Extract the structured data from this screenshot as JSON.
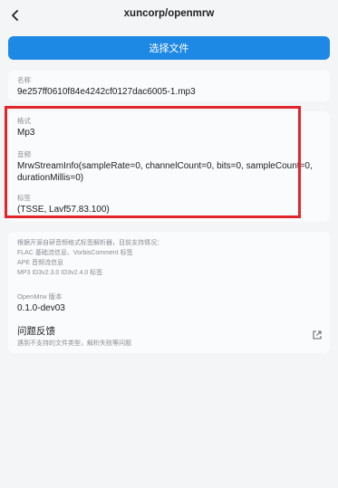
{
  "header": {
    "title": "xuncorp/openmrw",
    "back_icon": "chevron-left-icon"
  },
  "select_button": {
    "label": "选择文件"
  },
  "file_card": {
    "name_label": "名称",
    "name_value": "9e257ff0610f84e4242cf0127dac6005-1.mp3"
  },
  "meta_card": {
    "format_label": "格式",
    "format_value": "Mp3",
    "audio_label": "音频",
    "audio_value": "MrwStreamInfo(sampleRate=0, channelCount=0, bits=0, sampleCount=0, durationMillis=0)",
    "tags_label": "标签",
    "tags_value": "(TSSE, Lavf57.83.100)"
  },
  "about_card": {
    "support_lines": [
      "根据开源自研音频格式标签解析器，目前支持情况：",
      "FLAC 基础流信息、VorbisComment 标签",
      "APE 音频流信息",
      "MP3 ID3v2.3.0 ID3v2.4.0 标签"
    ],
    "version_label": "OpenMrw 版本",
    "version_value": "0.1.0-dev03",
    "feedback_title": "问题反馈",
    "feedback_sub": "遇到不支持的文件类型，解析失败等问题",
    "feedback_icon": "open-external-icon"
  },
  "colors": {
    "accent": "#1e88e5",
    "highlight": "#e0262b",
    "background": "#f4f5f7",
    "card": "#fafbfc"
  }
}
